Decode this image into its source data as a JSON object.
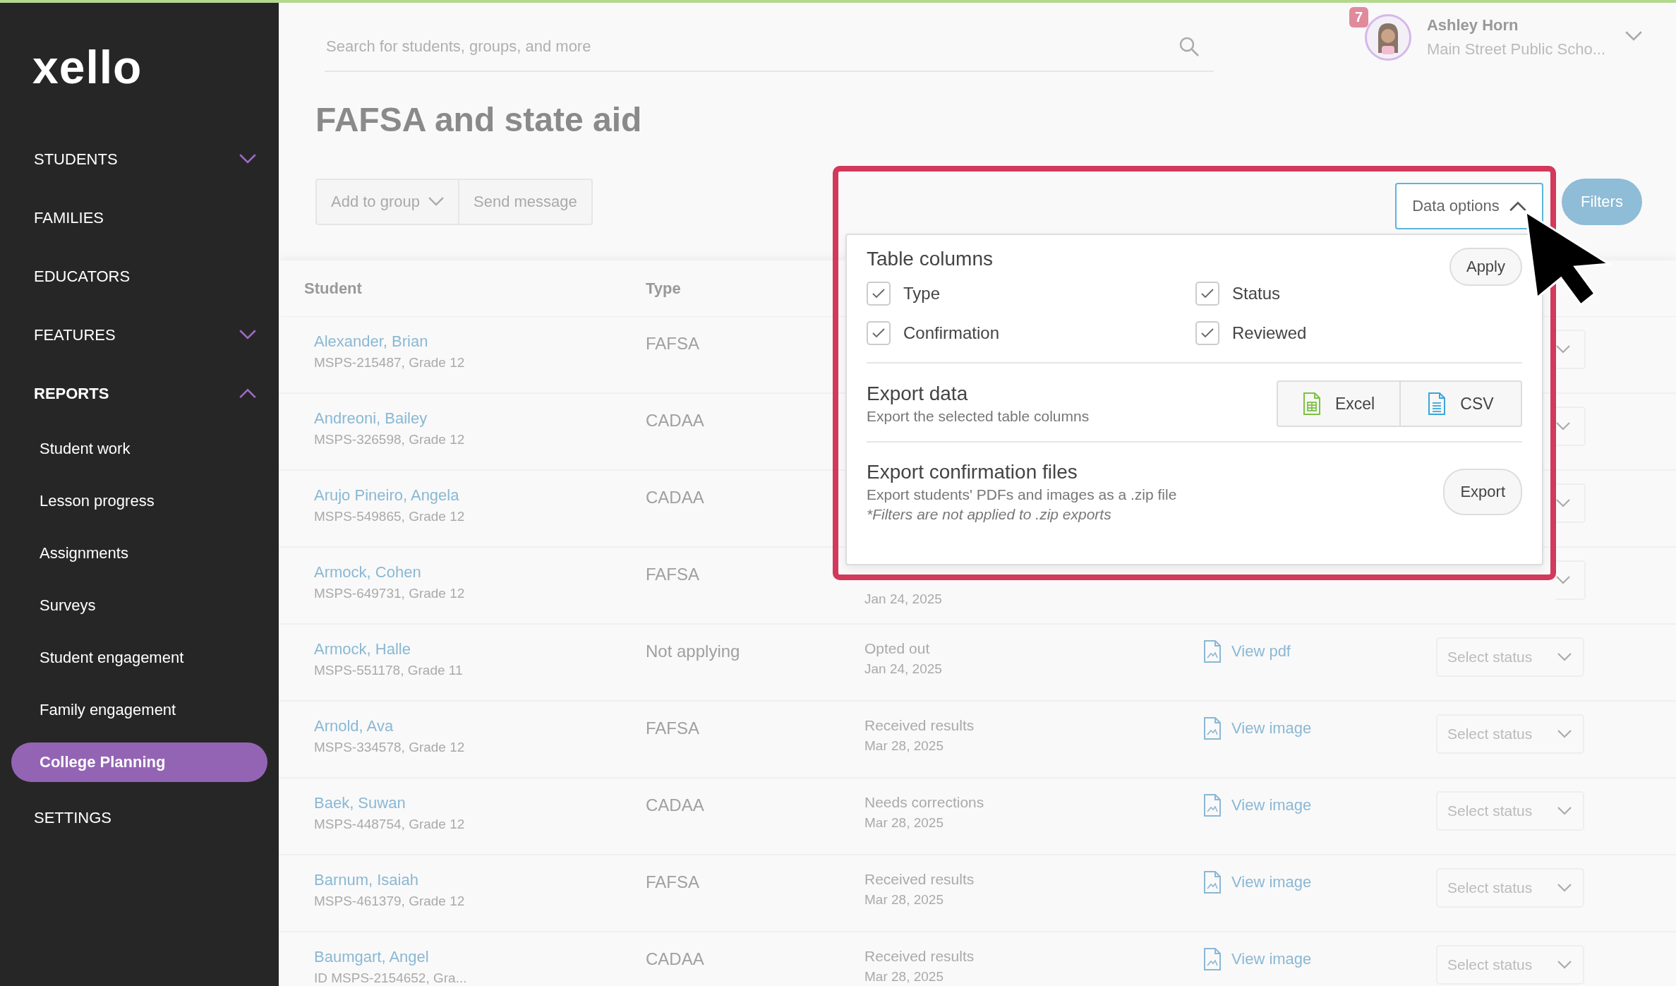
{
  "logo": "xello",
  "sidebar": {
    "items": [
      {
        "kind": "group",
        "label": "STUDENTS",
        "expanded": false
      },
      {
        "kind": "link",
        "label": "FAMILIES"
      },
      {
        "kind": "link",
        "label": "EDUCATORS"
      },
      {
        "kind": "group",
        "label": "FEATURES",
        "expanded": false
      },
      {
        "kind": "group",
        "label": "REPORTS",
        "expanded": true,
        "children": [
          {
            "label": "Student work",
            "selected": false
          },
          {
            "label": "Lesson progress",
            "selected": false
          },
          {
            "label": "Assignments",
            "selected": false
          },
          {
            "label": "Surveys",
            "selected": false
          },
          {
            "label": "Student engagement",
            "selected": false
          },
          {
            "label": "Family engagement",
            "selected": false
          },
          {
            "label": "College Planning",
            "selected": true
          }
        ]
      },
      {
        "kind": "link",
        "label": "SETTINGS"
      }
    ]
  },
  "search": {
    "placeholder": "Search for students, groups, and more"
  },
  "user": {
    "name": "Ashley Horn",
    "school": "Main Street Public Scho...",
    "badge": "7"
  },
  "title": "FAFSA and state aid",
  "toolbar": {
    "add_to_group": "Add to group",
    "send_message": "Send message",
    "filters": "Filters"
  },
  "data_options": {
    "label": "Data options",
    "expanded": true,
    "table_columns": {
      "title": "Table columns",
      "apply": "Apply",
      "columns": [
        {
          "label": "Type",
          "checked": true
        },
        {
          "label": "Status",
          "checked": true
        },
        {
          "label": "Confirmation",
          "checked": true
        },
        {
          "label": "Reviewed",
          "checked": true
        }
      ]
    },
    "export_data": {
      "title": "Export data",
      "subtitle": "Export the selected table columns",
      "excel": "Excel",
      "csv": "CSV"
    },
    "export_files": {
      "title": "Export confirmation files",
      "subtitle": "Export students' PDFs and images as a .zip file",
      "note": "*Filters are not applied to .zip exports",
      "button": "Export"
    }
  },
  "table": {
    "columns": [
      "Student",
      "Type"
    ],
    "rows": [
      {
        "name": "Alexander, Brian",
        "id": "MSPS-215487, Grade 12",
        "type": "FAFSA"
      },
      {
        "name": "Andreoni, Bailey",
        "id": "MSPS-326598, Grade 12",
        "type": "CADAA"
      },
      {
        "name": "Arujo Pineiro, Angela",
        "id": "MSPS-549865, Grade 12",
        "type": "CADAA"
      },
      {
        "name": "Armock, Cohen",
        "id": "MSPS-649731, Grade 12",
        "type": "FAFSA",
        "date": "Jan 24, 2025"
      },
      {
        "name": "Armock, Halle",
        "id": "MSPS-551178, Grade 11",
        "type": "Not applying",
        "status": "Opted out",
        "date": "Jan 24, 2025",
        "file": "View pdf",
        "select": "Select status"
      },
      {
        "name": "Arnold, Ava",
        "id": "MSPS-334578, Grade 12",
        "type": "FAFSA",
        "status": "Received results",
        "date": "Mar 28, 2025",
        "file": "View image",
        "select": "Select status"
      },
      {
        "name": "Baek, Suwan",
        "id": "MSPS-448754, Grade 12",
        "type": "CADAA",
        "status": "Needs corrections",
        "date": "Mar 28, 2025",
        "file": "View image",
        "select": "Select status"
      },
      {
        "name": "Barnum, Isaiah",
        "id": "MSPS-461379, Grade 12",
        "type": "FAFSA",
        "status": "Received results",
        "date": "Mar 28, 2025",
        "file": "View image",
        "select": "Select status"
      },
      {
        "name": "Baumgart, Angel",
        "id": "ID MSPS-2154652, Gra...",
        "type": "CADAA",
        "status": "Received results",
        "date": "Mar 28, 2025",
        "file": "View image",
        "select": "Select status"
      }
    ]
  }
}
